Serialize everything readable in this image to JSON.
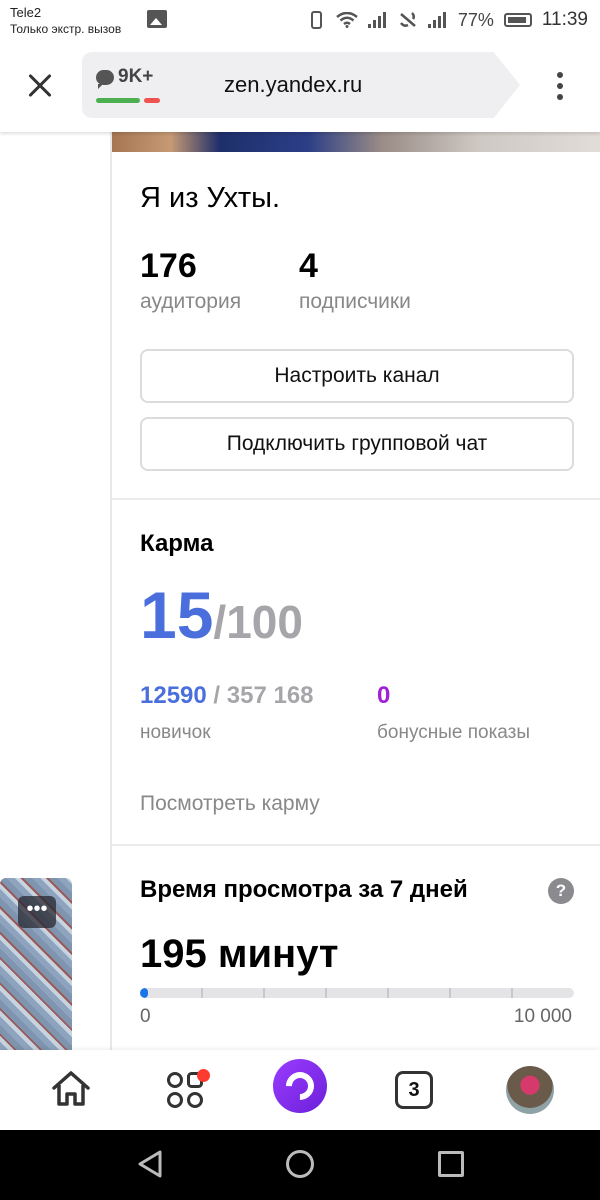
{
  "status_bar": {
    "carrier": "Tele2",
    "carrier_note": "Только экстр. вызов",
    "battery": "77%",
    "time": "11:39"
  },
  "browser": {
    "comments_count": "9K+",
    "url": "zen.yandex.ru",
    "karma_strip_colors": [
      "#4caf50",
      "#ef5350"
    ]
  },
  "channel": {
    "name": "Я из Ухты.",
    "audience_value": "176",
    "audience_label": "аудитория",
    "subscribers_value": "4",
    "subscribers_label": "подписчики",
    "setup_button": "Настроить канал",
    "group_chat_button": "Подключить групповой чат"
  },
  "karma": {
    "title": "Карма",
    "value": "15",
    "max": "/100",
    "rank": "12590",
    "rank_total": " / 357 168",
    "rank_label": "новичок",
    "bonus_value": "0",
    "bonus_label": "бонусные показы",
    "link": "Посмотреть карму"
  },
  "watch_time": {
    "title": "Время просмотра за 7 дней",
    "help": "?",
    "value": "195 минут",
    "scale_min": "0",
    "scale_max": "10 000",
    "progress_fraction": 0.0195
  },
  "left_card": {
    "more": "•••"
  },
  "bottom_nav": {
    "tabs_count": "3"
  },
  "colors": {
    "accent_blue": "#4a6fdc",
    "bonus_purple": "#a020d8",
    "alice_purple": "#7b2cf0",
    "notification_red": "#ff3b30"
  }
}
